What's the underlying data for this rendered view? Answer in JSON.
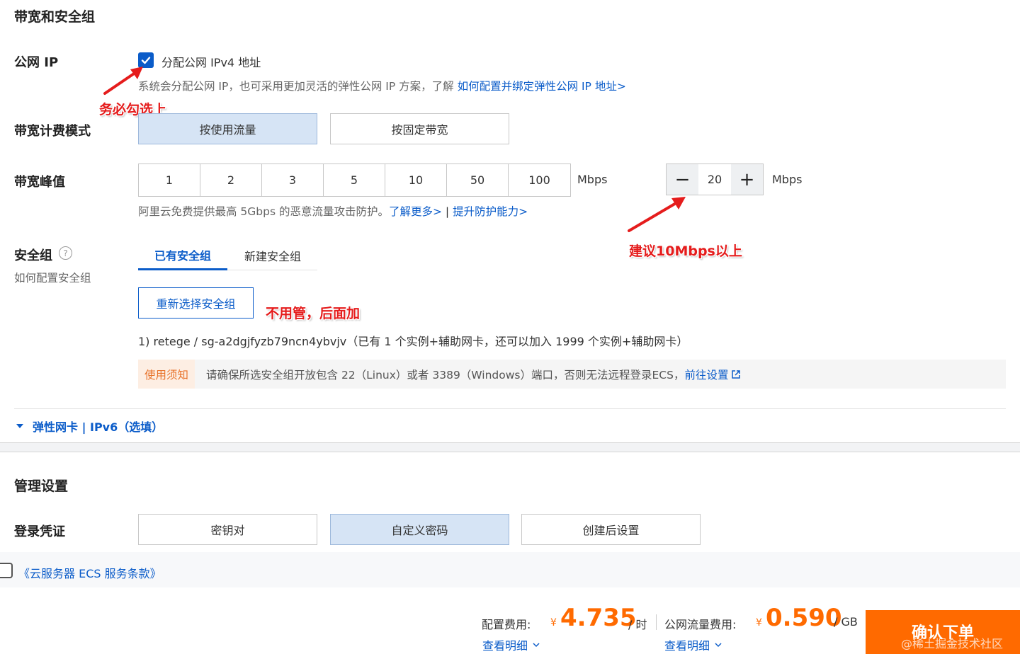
{
  "bandwidth_section": {
    "title": "带宽和安全组",
    "public_ip": {
      "label": "公网 IP",
      "checkbox_label": "分配公网 IPv4 地址",
      "checked": true,
      "hint": "系统会分配公网 IP，也可采用更加灵活的弹性公网 IP 方案，了解",
      "hint_link": "如何配置并绑定弹性公网 IP 地址>"
    },
    "billing": {
      "label": "带宽计费模式",
      "options": [
        "按使用流量",
        "按固定带宽"
      ],
      "selected": "按使用流量"
    },
    "peak": {
      "label": "带宽峰值",
      "options": [
        "1",
        "2",
        "3",
        "5",
        "10",
        "50",
        "100"
      ],
      "unit": "Mbps",
      "stepper_minus": "−",
      "stepper_value": "20",
      "stepper_plus": "+",
      "stepper_unit": "Mbps",
      "hint": "阿里云免费提供最高 5Gbps 的恶意流量攻击防护。",
      "hint_link1": "了解更多>",
      "hint_sep": "|",
      "hint_link2": "提升防护能力>"
    },
    "security_group": {
      "label": "安全组",
      "help_icon": "?",
      "sublabel": "如何配置安全组",
      "tabs": [
        "已有安全组",
        "新建安全组"
      ],
      "active_tab": "已有安全组",
      "reselect_button": "重新选择安全组",
      "group_line": "1) retege / sg-a2dgjfyzb79ncn4ybvjv（已有 1 个实例+辅助网卡，还可以加入 1999 个实例+辅助网卡）",
      "notice_tag": "使用须知",
      "notice_text": "请确保所选安全组开放包含 22（Linux）或者 3389（Windows）端口，否则无法远程登录ECS，",
      "notice_link": "前往设置"
    },
    "expander": "弹性网卡 | IPv6（选填）"
  },
  "annotations": {
    "check_required": "务必勾选上",
    "bandwidth_suggest": "建议10Mbps以上",
    "ignore_group": "不用管，后面加"
  },
  "management": {
    "title": "管理设置",
    "login": {
      "label": "登录凭证",
      "options": [
        "密钥对",
        "自定义密码",
        "创建后设置"
      ],
      "selected": "自定义密码"
    }
  },
  "terms": {
    "text": "《云服务器 ECS 服务条款》"
  },
  "footer": {
    "config_label": "配置费用:",
    "config_currency": "¥",
    "config_price": "4.735",
    "config_unit": "/ 时",
    "config_detail": "查看明细",
    "traffic_label": "公网流量费用:",
    "traffic_currency": "¥",
    "traffic_price": "0.590",
    "traffic_unit": "/ GB",
    "traffic_detail": "查看明细",
    "confirm_button": "确认下单",
    "watermark": "@稀土掘金技术社区"
  },
  "colors": {
    "link": "#0b5cc9",
    "selected_bg": "#d6e4f5",
    "price": "#ff6a00",
    "annotation": "#e51c1c"
  }
}
